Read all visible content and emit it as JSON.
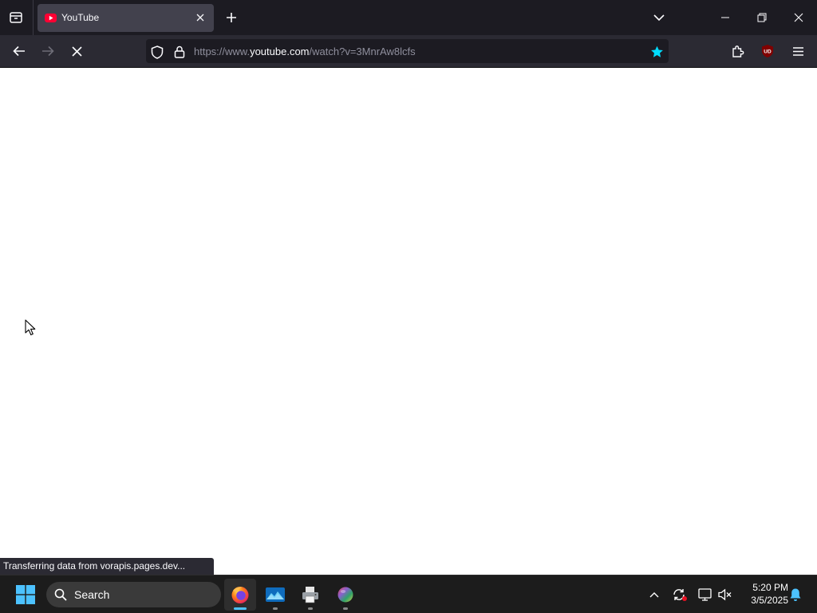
{
  "browser": {
    "tab": {
      "title": "YouTube",
      "favicon": "youtube-favicon-icon"
    },
    "url": {
      "prefix": "https://www.",
      "domain": "youtube.com",
      "path": "/watch?v=3MnrAw8lcfs"
    },
    "status_text": "Transferring data from vorapis.pages.dev...",
    "accent_color": "#00ddff",
    "loading": true
  },
  "taskbar": {
    "search_placeholder": "Search",
    "apps": [
      {
        "name": "Firefox",
        "icon": "firefox-icon",
        "active": true
      },
      {
        "name": "Photos",
        "icon": "photos-icon",
        "active": false
      },
      {
        "name": "Printer app",
        "icon": "printer-icon",
        "active": false
      },
      {
        "name": "Color app",
        "icon": "color-ball-icon",
        "active": false
      }
    ],
    "clock": {
      "time": "5:20 PM",
      "date": "3/5/2025"
    }
  }
}
